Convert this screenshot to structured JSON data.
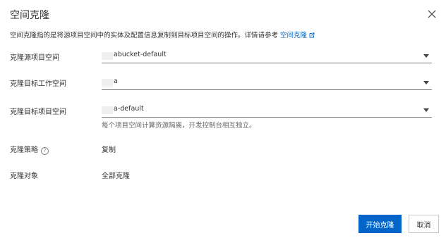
{
  "dialog": {
    "title": "空间克隆",
    "description": "空间克隆指的是将源项目空间中的实体及配置信息复制到目标项目空间的操作。详情请参考",
    "doc_link": "空间克隆",
    "close_icon": "close-icon",
    "link_icon": "external-link-icon"
  },
  "form": {
    "source_project": {
      "label": "克隆源项目空间",
      "value": "abucket-default"
    },
    "target_workspace": {
      "label": "克隆目标工作空间",
      "value": "a"
    },
    "target_project": {
      "label": "克隆目标项目空间",
      "value": "a-default",
      "hint": "每个项目空间计算资源隔离，开发控制台相互独立。"
    },
    "strategy": {
      "label": "克隆策略",
      "value": "复制",
      "help_icon": "question-circle-icon"
    },
    "object": {
      "label": "克隆对象",
      "value": "全部克隆"
    }
  },
  "footer": {
    "start_button": "开始克隆",
    "cancel_button": "取消"
  },
  "colors": {
    "primary": "#0064c8"
  }
}
